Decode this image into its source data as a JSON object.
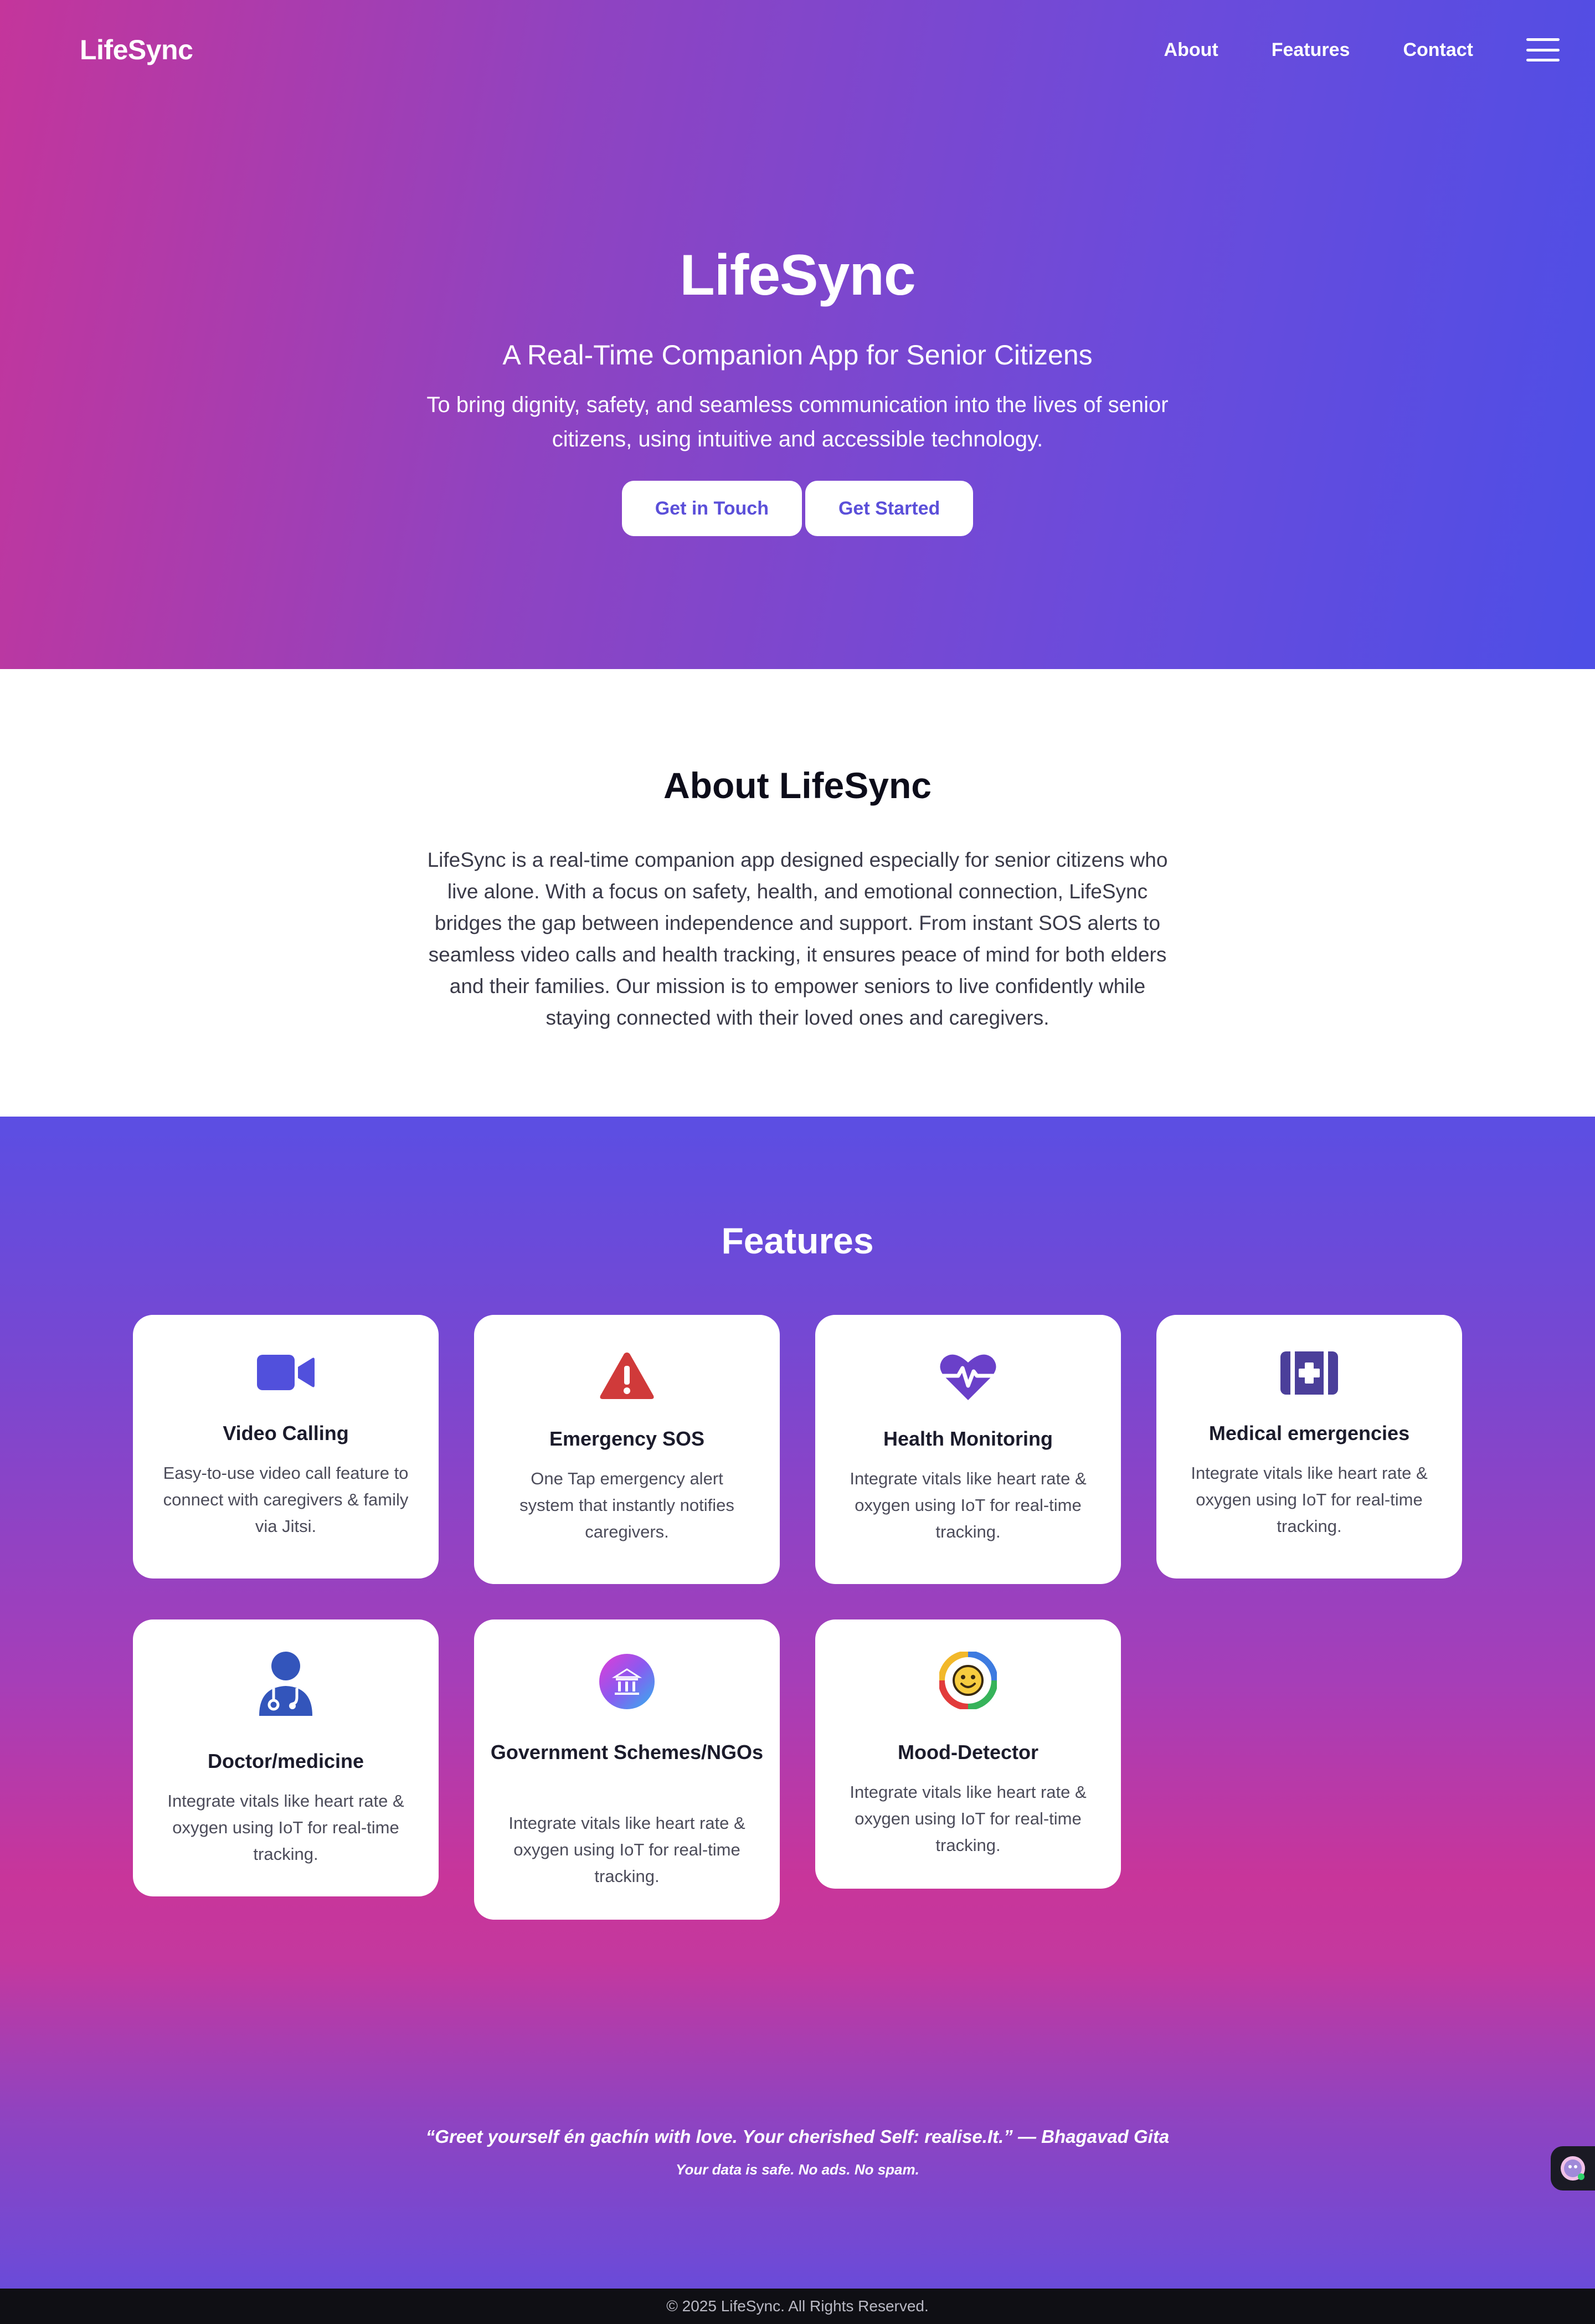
{
  "nav": {
    "brand": "LifeSync",
    "links": [
      "About",
      "Features",
      "Contact"
    ]
  },
  "hero": {
    "title": "LifeSync",
    "tagline": "A Real-Time Companion App for Senior Citizens",
    "description": "To bring dignity, safety, and seamless communication into the lives of senior citizens, using intuitive and accessible technology.",
    "primary_button": "Get in Touch",
    "secondary_button": "Get Started"
  },
  "about": {
    "heading": "About LifeSync",
    "body": "LifeSync is a real-time companion app designed especially for senior citizens who live alone. With a focus on safety, health, and emotional connection, LifeSync bridges the gap between independence and support. From instant SOS alerts to seamless video calls and health tracking, it ensures peace of mind for both elders and their families. Our mission is to empower seniors to live confidently while staying connected with their loved ones and caregivers."
  },
  "features": {
    "heading": "Features",
    "cards": [
      {
        "title": "Video Calling",
        "text": "Easy-to-use video call feature to connect with caregivers & family via Jitsi.",
        "icon": "video-camera-icon"
      },
      {
        "title": "Emergency SOS",
        "text": "One Tap emergency alert system that instantly notifies caregivers.",
        "icon": "warning-triangle-icon"
      },
      {
        "title": "Health Monitoring",
        "text": "Integrate vitals like heart rate & oxygen using IoT for real-time tracking.",
        "icon": "heart-pulse-icon"
      },
      {
        "title": "Medical emergencies",
        "text": "Integrate vitals like heart rate & oxygen using IoT for real-time tracking.",
        "icon": "medical-kit-icon"
      },
      {
        "title": "Doctor/medicine",
        "text": "Integrate vitals like heart rate & oxygen using IoT for real-time tracking.",
        "icon": "doctor-icon"
      },
      {
        "title": "Government Schemes/NGOs",
        "text": "Integrate vitals like heart rate & oxygen using IoT for real-time tracking.",
        "icon": "government-building-icon"
      },
      {
        "title": "Mood-Detector",
        "text": "Integrate vitals like heart rate & oxygen using IoT for real-time tracking.",
        "icon": "mood-face-icon"
      }
    ],
    "quote": "“Greet yourself én gachín with love. Your cherished Self: realise.It.” — Bhagavad Gita",
    "safe_note": "Your data is safe. No ads. No spam."
  },
  "footer": {
    "copyright": "© 2025 LifeSync. All Rights Reserved."
  },
  "colors": {
    "accent": "#5b4fd9",
    "gradient_pink": "#c4359b",
    "gradient_blue": "#4d4ee6",
    "sos_red": "#d03a3a"
  }
}
